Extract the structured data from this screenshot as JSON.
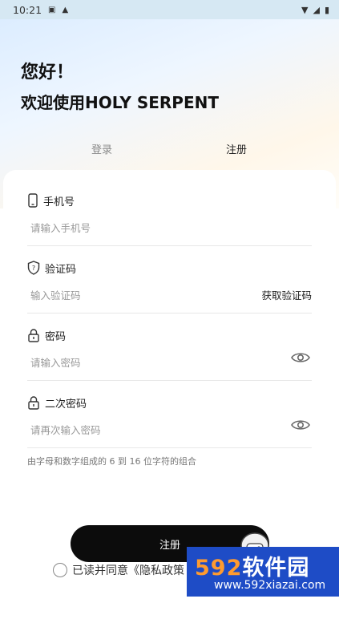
{
  "status_bar": {
    "time": "10:21"
  },
  "header": {
    "greeting": "您好！",
    "welcome": "欢迎使用HOLY SERPENT"
  },
  "tabs": {
    "login": "登录",
    "register": "注册",
    "active": "register"
  },
  "form": {
    "phone": {
      "label": "手机号",
      "placeholder": "请输入手机号"
    },
    "code": {
      "label": "验证码",
      "placeholder": "输入验证码",
      "get_code": "获取验证码"
    },
    "password": {
      "label": "密码",
      "placeholder": "请输入密码"
    },
    "confirm": {
      "label": "二次密码",
      "placeholder": "请再次输入密码"
    },
    "hint": "由字母和数字组成的 6 到 16 位字符的组合"
  },
  "submit_label": "注册",
  "agreement": {
    "text": "已读并同意《隐私政策"
  },
  "watermark": {
    "num": "592",
    "brand": "软件园",
    "url": "www.592xiazai.com"
  }
}
